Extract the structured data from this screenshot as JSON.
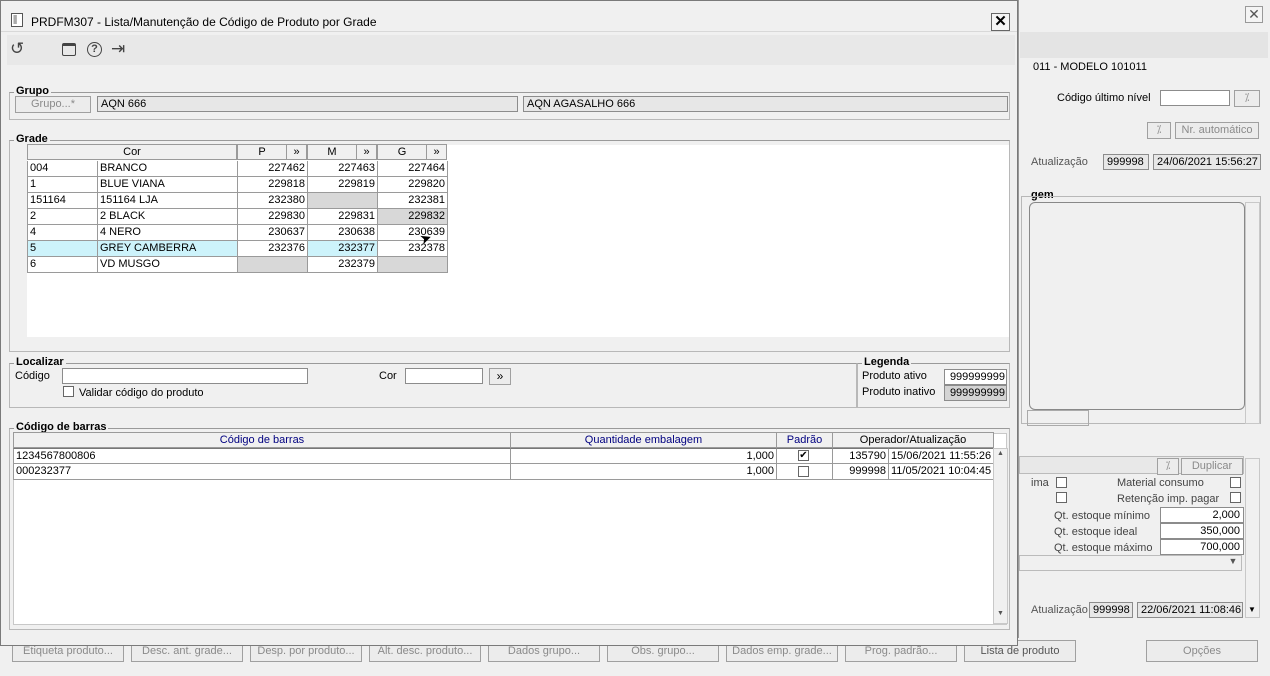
{
  "main": {
    "title": "PRDFM307 - Lista/Manutenção de Código de Produto por Grade",
    "grupo": {
      "legend": "Grupo",
      "button": "Grupo...*",
      "code": "AQN 666",
      "desc": "AQN AGASALHO 666"
    },
    "grade": {
      "legend": "Grade",
      "headers": {
        "cor": "Cor",
        "p": "P",
        "m": "M",
        "g": "G",
        "more": "»"
      },
      "rows": [
        {
          "code": "004",
          "name": "BRANCO",
          "p": "227462",
          "m": "227463",
          "g": "227464"
        },
        {
          "code": "1",
          "name": "BLUE VIANA",
          "p": "229818",
          "m": "229819",
          "g": "229820"
        },
        {
          "code": "151164",
          "name": "151164 LJA",
          "p": "232380",
          "m": "",
          "g": "232381"
        },
        {
          "code": "2",
          "name": "2 BLACK",
          "p": "229830",
          "m": "229831",
          "g": "229832"
        },
        {
          "code": "4",
          "name": "4 NERO",
          "p": "230637",
          "m": "230638",
          "g": "230639"
        },
        {
          "code": "5",
          "name": "GREY CAMBERRA",
          "p": "232376",
          "m": "232377",
          "g": "232378"
        },
        {
          "code": "6",
          "name": "VD MUSGO",
          "p": "",
          "m": "232379",
          "g": ""
        }
      ]
    },
    "localizar": {
      "legend": "Localizar",
      "codigo_label": "Código",
      "codigo_value": "",
      "cor_label": "Cor",
      "cor_value": "",
      "go": "»",
      "validar_label": "Validar código do produto"
    },
    "legenda": {
      "legend": "Legenda",
      "ativo_label": "Produto ativo",
      "ativo_value": "999999999",
      "inativo_label": "Produto inativo",
      "inativo_value": "999999999"
    },
    "barras": {
      "legend": "Código de barras",
      "headers": {
        "codigo": "Código de barras",
        "qtd": "Quantidade embalagem",
        "padrao": "Padrão",
        "oper": "Operador/Atualização"
      },
      "rows": [
        {
          "codigo": "1234567800806",
          "qtd": "1,000",
          "padrao": true,
          "operador": "135790",
          "data": "15/06/2021 11:55:26"
        },
        {
          "codigo": "000232377",
          "qtd": "1,000",
          "padrao": false,
          "operador": "999998",
          "data": "11/05/2021 10:04:45"
        }
      ]
    }
  },
  "background": {
    "header": "011 - MODELO 101011",
    "codigo_ultimo_nivel_label": "Código último nível",
    "nr_automatico": "Nr. automático",
    "atualizacao_label": "Atualização",
    "atualizacao_user": "999998",
    "atualizacao_date": "24/06/2021 15:56:27",
    "gem_label": "gem",
    "duplicar": "Duplicar",
    "ima_label": "ima",
    "material_consumo": "Material consumo",
    "retencao": "Retenção imp. pagar",
    "estoque_minimo_label": "Qt. estoque mínimo",
    "estoque_minimo": "2,000",
    "estoque_ideal_label": "Qt. estoque ideal",
    "estoque_ideal": "350,000",
    "estoque_maximo_label": "Qt. estoque máximo",
    "estoque_maximo": "700,000",
    "atualizacao2_user": "999998",
    "atualizacao2_date": "22/06/2021 11:08:46",
    "opcoes": "Opções"
  },
  "bottom_buttons": [
    "Etiqueta produto...",
    "Desc. ant. grade...",
    "Desp. por produto...",
    "Alt. desc. produto...",
    "Dados grupo...",
    "Obs. grupo...",
    "Dados emp. grade...",
    "Prog. padrão...",
    "Lista de produto"
  ],
  "colors": {
    "highlight_row": "#cdf3fb",
    "title_bg": "#f0f0f0",
    "header_text": "#000080"
  }
}
